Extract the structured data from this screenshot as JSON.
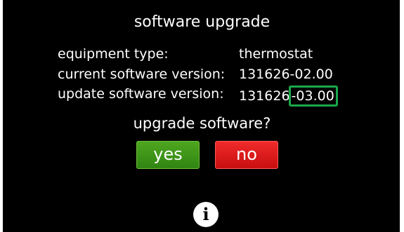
{
  "screen": {
    "title": "software upgrade",
    "details": [
      {
        "label": "equipment type:",
        "value": "thermostat"
      },
      {
        "label": "current software version:",
        "value": "131626-02.00"
      },
      {
        "label": "update software version:",
        "value_prefix": "131626",
        "value_highlight": "-03.00"
      }
    ],
    "prompt": "upgrade software?",
    "buttons": {
      "yes": "yes",
      "no": "no"
    },
    "info_button": {
      "icon": "info-icon",
      "glyph": "i"
    }
  },
  "colors": {
    "background": "#000000",
    "text": "#ffffff",
    "yes_button": "#3e9a18",
    "no_button": "#e01c1c",
    "highlight_box": "#1aa84a"
  }
}
